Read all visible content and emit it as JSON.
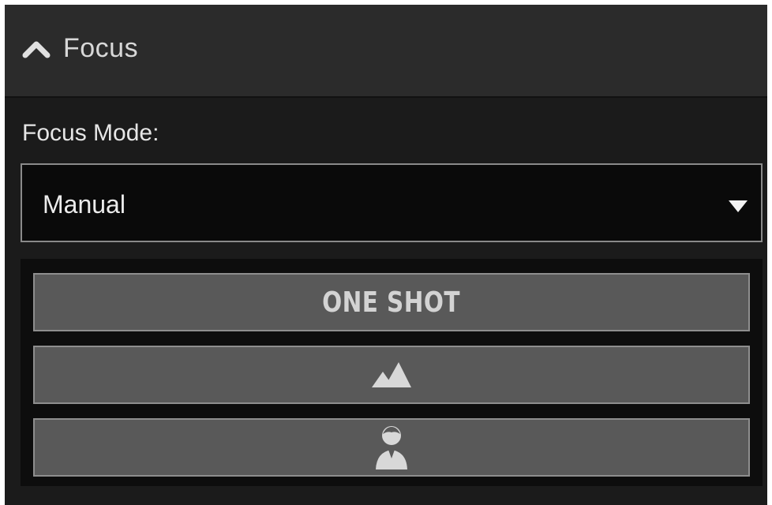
{
  "panel": {
    "title": "Focus",
    "collapse_icon": "chevron-up-icon"
  },
  "focus_mode": {
    "label": "Focus Mode:",
    "selected": "Manual",
    "dropdown_icon": "caret-down-icon"
  },
  "buttons": [
    {
      "label": "ONE SHOT"
    },
    {
      "icon": "mountains-icon"
    },
    {
      "icon": "person-icon"
    }
  ],
  "colors": {
    "panel_bg": "#1b1b1b",
    "header_bg": "#2b2b2b",
    "button_bg": "#595959",
    "text": "#d8d8d8"
  }
}
